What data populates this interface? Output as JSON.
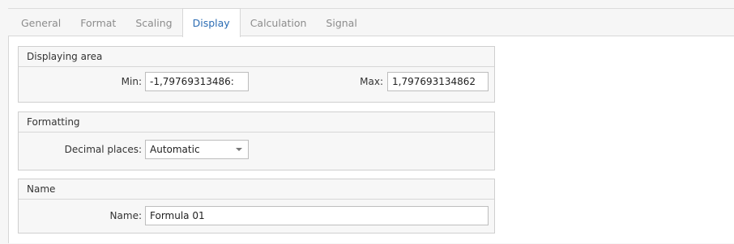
{
  "tabs": [
    "General",
    "Format",
    "Scaling",
    "Display",
    "Calculation",
    "Signal"
  ],
  "active_tab": "Display",
  "displaying_area": {
    "title": "Displaying area",
    "min_label": "Min:",
    "min_value": "-1,79769313486:",
    "max_label": "Max:",
    "max_value": "1,797693134862"
  },
  "formatting": {
    "title": "Formatting",
    "decimal_label": "Decimal places:",
    "decimal_value": "Automatic"
  },
  "name_group": {
    "title": "Name",
    "name_label": "Name:",
    "name_value": "Formula 01"
  },
  "colors": {
    "active_tab_text": "#2b6cb3",
    "inactive_tab_text": "#8c8c8c",
    "group_background": "#f7f7f7"
  }
}
